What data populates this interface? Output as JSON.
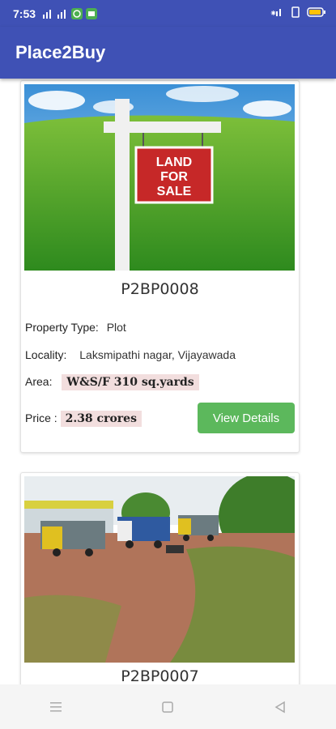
{
  "status": {
    "time": "7:53"
  },
  "app": {
    "title": "Place2Buy"
  },
  "listings": [
    {
      "code": "P2BP0008",
      "sign_text": "LAND FOR SALE",
      "property_type_label": "Property Type:",
      "property_type": "Plot",
      "locality_label": "Locality:",
      "locality": "Laksmipathi nagar, Vijayawada",
      "area_label": "Area:",
      "area": "W&S/F 310 sq.yards",
      "price_label": "Price :",
      "price": "2.38 crores",
      "button": "View Details"
    },
    {
      "code": "P2BP0007"
    }
  ],
  "colors": {
    "primary": "#3f51b5",
    "button": "#5cb85c",
    "highlight": "#f2dede"
  },
  "nav": {
    "icons": [
      "menu-icon",
      "home-icon",
      "back-icon"
    ]
  }
}
